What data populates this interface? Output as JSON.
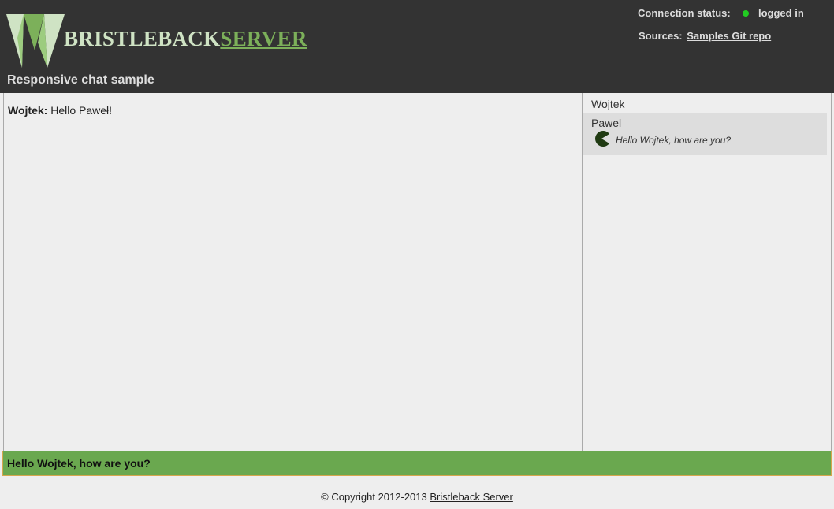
{
  "header": {
    "logo_word1": "BRISTLEBACK",
    "logo_word2": "SERVER",
    "subtitle": "Responsive chat sample",
    "connection_label": "Connection status:",
    "connection_value": "logged in",
    "connection_color": "#22cc22",
    "sources_label": "Sources:",
    "sources_link": "Samples Git repo"
  },
  "chat": {
    "messages": [
      {
        "author": "Wojtek:",
        "text": "Hello Paweł!"
      }
    ]
  },
  "users": [
    {
      "name": "Wojtek",
      "active": false,
      "typing": ""
    },
    {
      "name": "Pawel",
      "active": true,
      "typing": "Hello Wojtek, how are you?",
      "typing_icon": "pacman-icon"
    }
  ],
  "input": {
    "value": "Hello Wojtek, how are you?"
  },
  "footer": {
    "copyright": "© Copyright 2012-2013",
    "link": "Bristleback Server"
  },
  "colors": {
    "header_bg": "#333333",
    "input_bg": "#6aa84f",
    "logo_light": "#cfe3c4",
    "logo_green": "#7cb05a"
  }
}
